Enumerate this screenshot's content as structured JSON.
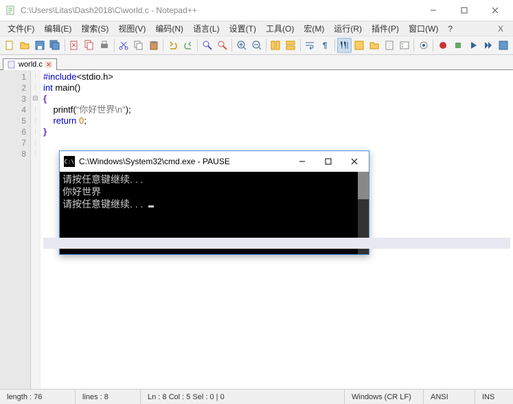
{
  "window": {
    "title": "C:\\Users\\Litas\\Dash2018\\C\\world.c - Notepad++"
  },
  "menu": {
    "items": [
      "文件(F)",
      "编辑(E)",
      "搜索(S)",
      "视图(V)",
      "编码(N)",
      "语言(L)",
      "设置(T)",
      "工具(O)",
      "宏(M)",
      "运行(R)",
      "插件(P)",
      "窗口(W)",
      "?"
    ]
  },
  "tab": {
    "filename": "world.c"
  },
  "code": {
    "lines": [
      {
        "n": "1",
        "html": "<span class='kw'>#include</span>&lt;stdio.h&gt;"
      },
      {
        "n": "2",
        "html": "<span class='kw'>int</span> main()"
      },
      {
        "n": "3",
        "html": "<span class='brace'>{</span>",
        "fold": "⊟"
      },
      {
        "n": "4",
        "html": "    printf(<span class='str'>\"你好世界\\n\"</span>);"
      },
      {
        "n": "5",
        "html": "    <span class='kw'>return</span> <span class='num'>0</span>;"
      },
      {
        "n": "6",
        "html": "<span class='brace'>}</span>"
      },
      {
        "n": "7",
        "html": ""
      },
      {
        "n": "8",
        "html": "",
        "hl": true
      }
    ]
  },
  "status": {
    "length": "length : 76",
    "lines": "lines : 8",
    "pos": "Ln : 8    Col : 5    Sel : 0 | 0",
    "eol": "Windows (CR LF)",
    "encoding": "ANSI",
    "mode": "INS"
  },
  "cmd": {
    "title": "C:\\Windows\\System32\\cmd.exe - PAUSE",
    "line1": "请按任意键继续. . .",
    "line2": "你好世界",
    "line3": "请按任意键继续. . . "
  }
}
